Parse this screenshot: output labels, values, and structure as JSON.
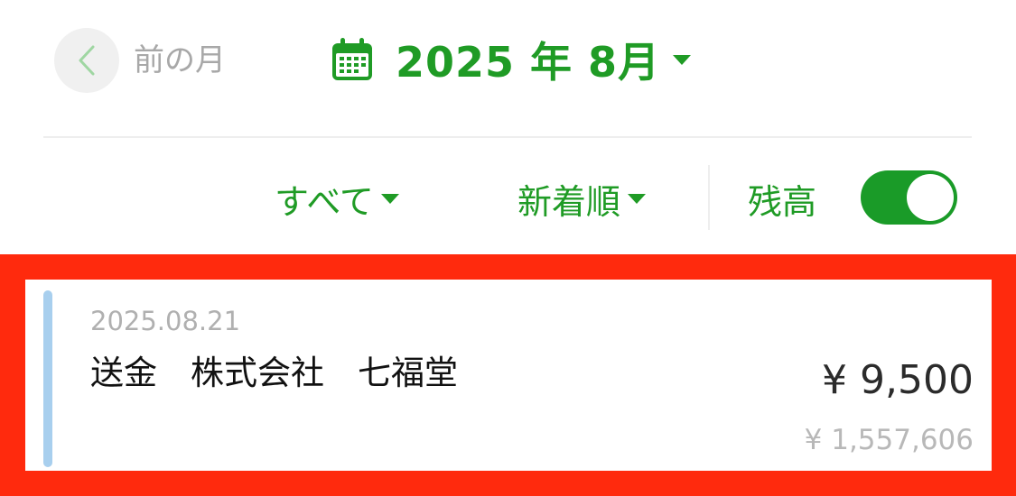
{
  "header": {
    "prev_month_label": "前の月",
    "month_label": "2025 年 8月",
    "icons": {
      "back": "chevron-left-icon",
      "calendar": "calendar-icon",
      "month_caret": "caret-down-icon"
    }
  },
  "filters": {
    "category_label": "すべて",
    "sort_label": "新着順",
    "balance_label": "残高",
    "balance_toggle_on": true
  },
  "transaction": {
    "date": "2025.08.21",
    "description": "送金　株式会社　七福堂",
    "amount": "¥ 9,500",
    "balance": "¥ 1,557,606"
  },
  "colors": {
    "accent_green": "#1f9b25",
    "toggle_green": "#1a9b28",
    "highlight_red": "#ff2a0d",
    "card_accent_blue": "#a8cfee",
    "muted_gray": "#a8a8a8"
  }
}
